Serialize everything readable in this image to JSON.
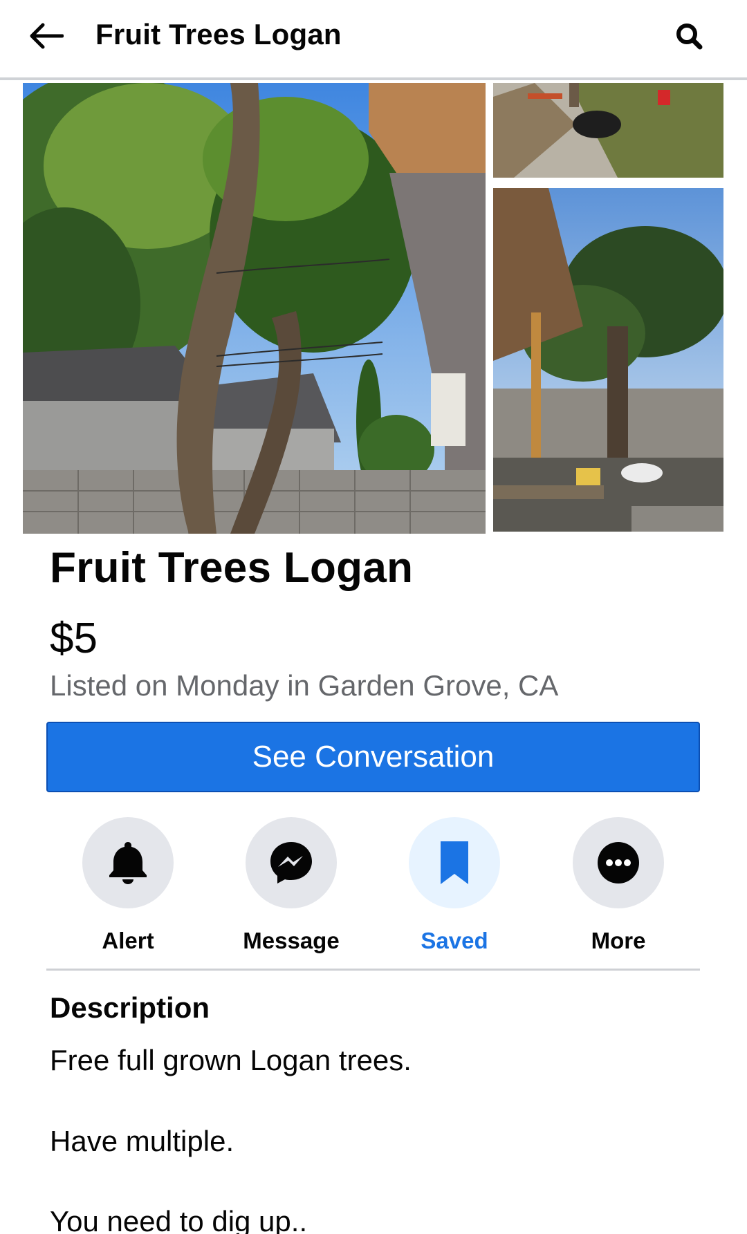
{
  "header": {
    "title": "Fruit Trees Logan"
  },
  "listing": {
    "title": "Fruit Trees Logan",
    "price": "$5",
    "meta": "Listed on Monday in Garden Grove, CA"
  },
  "cta": {
    "label": "See Conversation"
  },
  "actions": [
    {
      "label": "Alert",
      "icon": "bell-icon"
    },
    {
      "label": "Message",
      "icon": "messenger-icon"
    },
    {
      "label": "Saved",
      "icon": "bookmark-icon",
      "active": true
    },
    {
      "label": "More",
      "icon": "more-dots-icon"
    }
  ],
  "description": {
    "heading": "Description",
    "lines": [
      "Free full grown Logan trees.",
      "Have multiple.",
      "You need to dig up.."
    ]
  },
  "colors": {
    "accent": "#1b74e4",
    "secondary_text": "#65676b",
    "button_bg": "#e4e6eb",
    "active_button_bg": "#e7f3ff"
  }
}
